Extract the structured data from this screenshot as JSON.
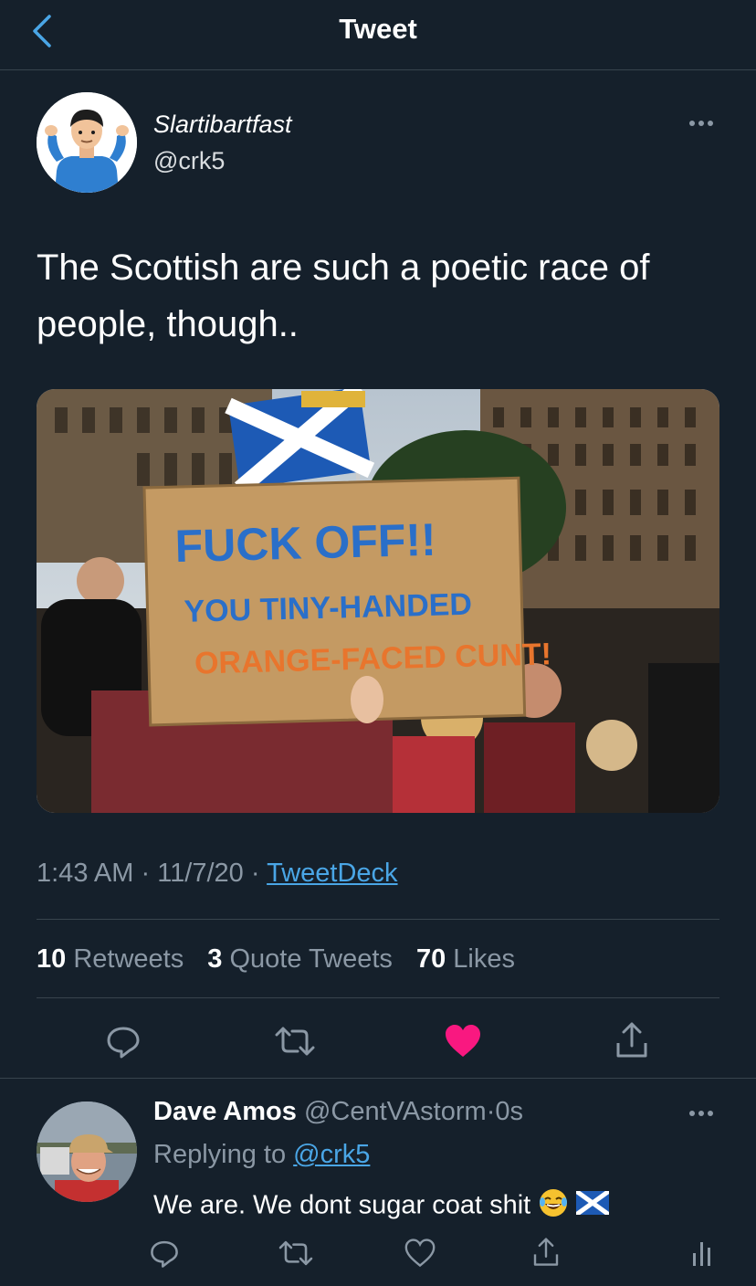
{
  "header": {
    "title": "Tweet"
  },
  "tweet": {
    "author_name": "Slartibartfast",
    "author_handle": "@crk5",
    "text": "The Scottish are such a poetic race of people, though..",
    "photo_sign": {
      "line1": "FUCK OFF!!",
      "line2": "YOU TINY-HANDED",
      "line3": "ORANGE-FACED CUNT!"
    },
    "time": "1:43 AM",
    "sep": "·",
    "date": "11/7/20",
    "source": "TweetDeck",
    "stats": {
      "retweets_count": "10",
      "retweets_label": "Retweets",
      "quotes_count": "3",
      "quotes_label": "Quote Tweets",
      "likes_count": "70",
      "likes_label": "Likes"
    }
  },
  "reply": {
    "name": "Dave Amos",
    "handle": "@CentVAstorm",
    "sep": "·",
    "time": "0s",
    "replying_label": "Replying to",
    "replying_handle": "@crk5",
    "text": "We are. We dont sugar coat shit"
  },
  "colors": {
    "background": "#15202b",
    "border": "#38444d",
    "secondary_text": "#8b98a5",
    "link": "#4aa6e6",
    "like_active": "#f91880"
  }
}
